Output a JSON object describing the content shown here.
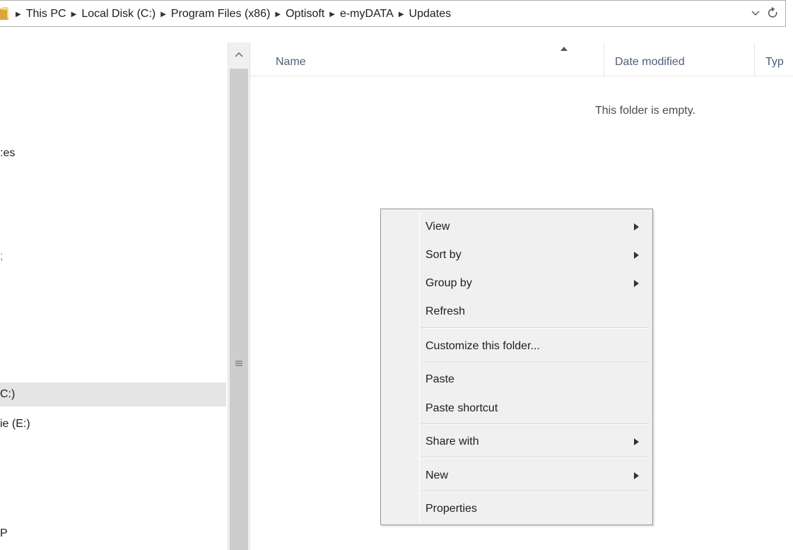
{
  "addressbar": {
    "breadcrumbs": [
      "This PC",
      "Local Disk (C:)",
      "Program Files (x86)",
      "Optisoft",
      "e-myDATA",
      "Updates"
    ]
  },
  "navpane": {
    "items": [
      ":es",
      ";",
      "C:)",
      "ie (E:)",
      "P"
    ]
  },
  "content": {
    "columns": {
      "name": "Name",
      "date_modified": "Date modified",
      "type": "Typ"
    },
    "empty_message": "This folder is empty."
  },
  "context_menu": {
    "items": [
      {
        "label": "View",
        "submenu": true
      },
      {
        "label": "Sort by",
        "submenu": true
      },
      {
        "label": "Group by",
        "submenu": true
      },
      {
        "label": "Refresh",
        "submenu": false
      },
      {
        "label": "Customize this folder...",
        "submenu": false
      },
      {
        "label": "Paste",
        "submenu": false
      },
      {
        "label": "Paste shortcut",
        "submenu": false
      },
      {
        "label": "Share with",
        "submenu": true
      },
      {
        "label": "New",
        "submenu": true
      },
      {
        "label": "Properties",
        "submenu": false
      }
    ]
  },
  "colors": {
    "folder_icon": "#e8b84a",
    "header_text": "#4c607a",
    "selected_nav": "#e5e5e5",
    "menu_background": "#f0f0f0"
  }
}
